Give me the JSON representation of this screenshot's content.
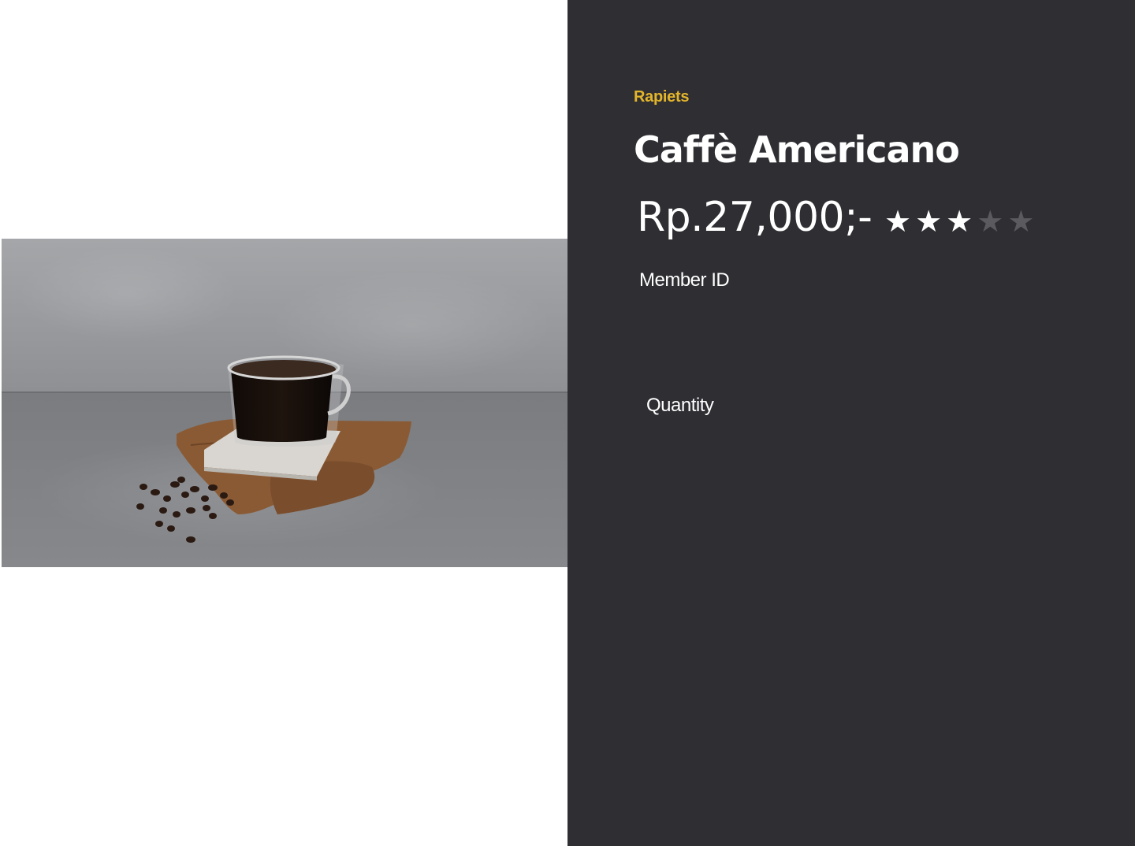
{
  "product": {
    "brand": "Rapiets",
    "name": "Caffè Americano",
    "price": "Rp.27,000;-",
    "rating": 3,
    "rating_max": 5,
    "image_icon": "coffee-cup-photo"
  },
  "form": {
    "member_id_label": "Member ID",
    "quantity_label": "Quantity"
  },
  "colors": {
    "panel_background": "#2e2e33",
    "brand_accent": "#e3b52b",
    "star_filled": "#ffffff",
    "star_empty": "#5a5a5f"
  }
}
